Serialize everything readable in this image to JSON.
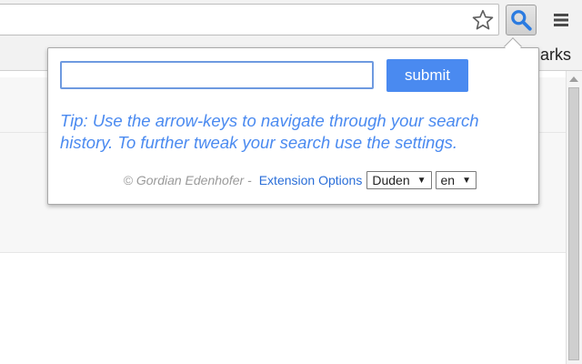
{
  "bookmarks_bar": {
    "visible_text": "arks"
  },
  "toolbar": {
    "star_icon": "star-outline-icon",
    "search_extension_icon": "magnifier-icon",
    "menu_icon": "hamburger-menu-icon"
  },
  "popup": {
    "search": {
      "value": "",
      "placeholder": ""
    },
    "submit_label": "submit",
    "tip": "Tip: Use the arrow-keys to navigate through your search history. To further tweak your search use the settings.",
    "copyright": "© Gordian Edenhofer -",
    "extension_options_label": "Extension Options",
    "dictionary_select": {
      "selected": "Duden",
      "arrow": "▼"
    },
    "language_select": {
      "selected": "en",
      "arrow": "▼"
    }
  },
  "colors": {
    "accent": "#4a8af0",
    "link": "#2a6ed8",
    "muted_text": "#9a9a9a",
    "magnifier": "#2b7be0"
  }
}
